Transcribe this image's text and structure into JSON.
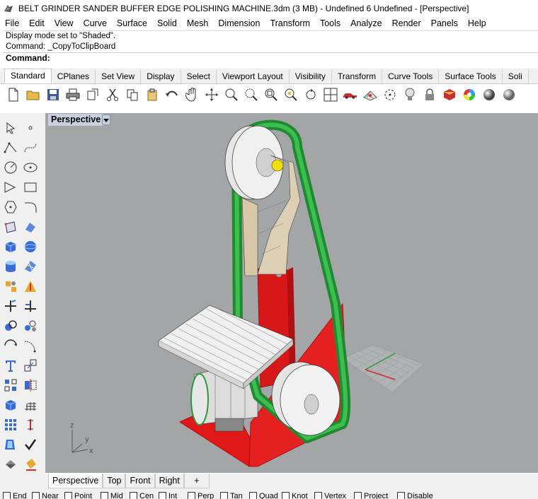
{
  "window": {
    "title": "BELT GRINDER SANDER BUFFER EDGE POLISHING MACHINE.3dm (3 MB) - Undefined 6 Undefined - [Perspective]",
    "app_icon": "rhino-icon"
  },
  "menu": [
    "File",
    "Edit",
    "View",
    "Curve",
    "Surface",
    "Solid",
    "Mesh",
    "Dimension",
    "Transform",
    "Tools",
    "Analyze",
    "Render",
    "Panels",
    "Help"
  ],
  "command_history": [
    "Display mode set to \"Shaded\".",
    "Command: _CopyToClipBoard"
  ],
  "command_prompt": "Command:",
  "toolbar_tabs": [
    "Standard",
    "CPlanes",
    "Set View",
    "Display",
    "Select",
    "Viewport Layout",
    "Visibility",
    "Transform",
    "Curve Tools",
    "Surface Tools",
    "Soli"
  ],
  "active_toolbar_tab": "Standard",
  "toolbar_icons": [
    "new-icon",
    "open-icon",
    "save-icon",
    "print-icon",
    "import-icon",
    "cut-icon",
    "copy-icon",
    "paste-icon",
    "undo-icon",
    "pan-icon",
    "rotate-view-icon",
    "zoom-icon",
    "zoom-window-icon",
    "zoom-extents-icon",
    "zoom-selected-icon",
    "rotate-icon",
    "four-viewports-icon",
    "car-icon",
    "grid-icon",
    "circle-icon",
    "bulb-icon",
    "lock-icon",
    "material-icon",
    "color-wheel-icon",
    "sphere-shaded-icon",
    "sphere-render-icon"
  ],
  "sidebar_icons": [
    "select-arrow-icon",
    "point-icon",
    "polyline-icon",
    "curve-icon",
    "circle-icon",
    "ellipse-icon",
    "arc-icon",
    "rectangle-icon",
    "polygon-icon",
    "fillet-curve-icon",
    "surface-pts-icon",
    "extrude-icon",
    "box-icon",
    "sphere-icon",
    "cylinder-icon",
    "surface-icon",
    "explode-icon",
    "boolean-icon",
    "trim-icon",
    "split-icon",
    "group-icon",
    "ungroup-icon",
    "offset-icon",
    "blend-icon",
    "text-icon",
    "scale-icon",
    "array-icon",
    "mirror-icon",
    "solid-edit-icon",
    "mesh-icon",
    "grid-array-icon",
    "dimension-icon",
    "layers-icon",
    "check-icon",
    "paint-icon",
    "bucket-icon"
  ],
  "viewport": {
    "label": "Perspective",
    "axis_labels": {
      "x": "x",
      "y": "y",
      "z": "z"
    },
    "colors": {
      "background": "#a3a5a7",
      "belt": "#2e9e3e",
      "base": "#e01818",
      "wheel": "#e8e8e8",
      "arm": "#d8c8a8"
    }
  },
  "viewport_tabs": [
    "Perspective",
    "Top",
    "Front",
    "Right"
  ],
  "active_viewport_tab": "Perspective",
  "add_tab_label": "+",
  "status_items": [
    "End",
    "Near",
    "Point",
    "Mid",
    "Cen",
    "Int",
    "Perp",
    "Tan",
    "Quad",
    "Knot",
    "Vertex",
    "Project",
    "Disable"
  ]
}
